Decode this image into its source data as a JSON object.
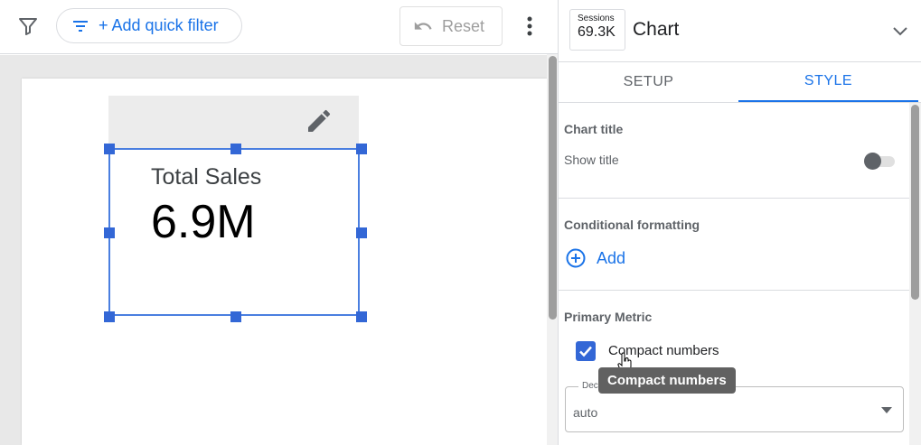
{
  "toolbar": {
    "quick_filter_label": "+ Add quick filter",
    "reset_label": "Reset"
  },
  "scorecard": {
    "label": "Total Sales",
    "value": "6.9M"
  },
  "panel": {
    "thumb_label": "Sessions",
    "thumb_value": "69.3K",
    "title": "Chart",
    "tabs": [
      "SETUP",
      "STYLE"
    ],
    "active_tab": "STYLE",
    "chart_title_section": {
      "heading": "Chart title",
      "show_title_label": "Show title",
      "show_title_on": false
    },
    "conditional_formatting": {
      "heading": "Conditional formatting",
      "add_label": "Add"
    },
    "primary_metric": {
      "heading": "Primary Metric",
      "compact_numbers_label": "Compact numbers",
      "compact_numbers_checked": true,
      "tooltip": "Compact numbers",
      "decimal_field_label": "Dec",
      "decimal_value": "auto"
    }
  },
  "colors": {
    "accent": "#1a73e8",
    "selection": "#3367d6",
    "tooltip_bg": "#616161"
  },
  "icons": [
    "filter-icon",
    "filter-list-icon",
    "undo-icon",
    "more-vert-icon",
    "pencil-icon",
    "chevron-down-icon",
    "add-circle-icon",
    "check-icon",
    "hand-cursor-icon",
    "dropdown-arrow-icon"
  ]
}
